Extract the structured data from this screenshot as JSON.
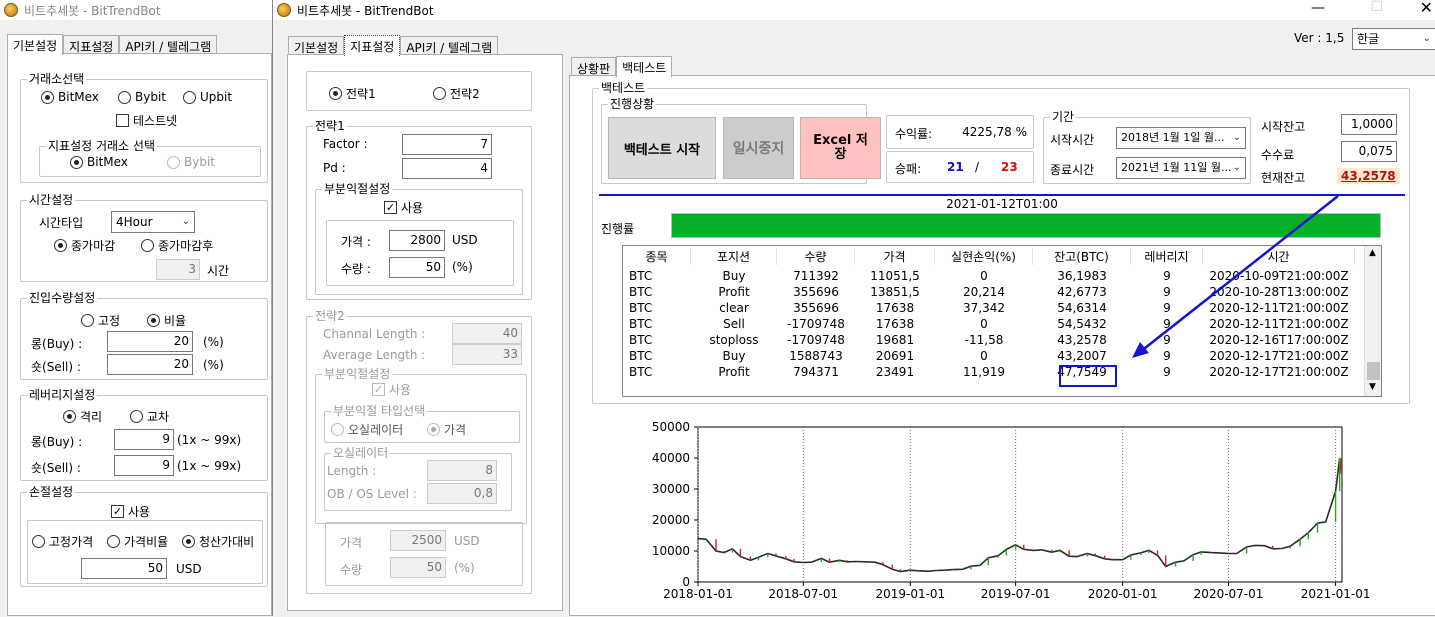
{
  "left_window": {
    "title": "비트추세봇 - BitTrendBot",
    "tabs": [
      "기본설정",
      "지표설정",
      "API키 / 텔레그램"
    ],
    "exchange_group": {
      "legend": "거래소선택",
      "options": [
        "BitMex",
        "Bybit",
        "Upbit"
      ],
      "selected": "BitMex",
      "testnet_label": "테스트넷",
      "indicator_exchange": {
        "legend": "지표설정 거래소 선택",
        "options": [
          "BitMex",
          "Bybit"
        ],
        "selected": "BitMex"
      }
    },
    "time_group": {
      "legend": "시간설정",
      "type_label": "시간타입",
      "type_value": "4Hour",
      "options": [
        "종가마감",
        "종가마감후"
      ],
      "selected": "종가마감",
      "hours_value": "3",
      "hours_unit": "시간"
    },
    "entry_group": {
      "legend": "진입수량설정",
      "options": [
        "고정",
        "비율"
      ],
      "selected": "비율",
      "long_label": "롱(Buy) :",
      "long_value": "20",
      "long_unit": "(%)",
      "short_label": "숏(Sell) :",
      "short_value": "20",
      "short_unit": "(%)"
    },
    "leverage_group": {
      "legend": "레버리지설정",
      "options": [
        "격리",
        "교차"
      ],
      "selected": "격리",
      "long_label": "롱(Buy) :",
      "long_value": "9",
      "long_range": "(1x ~ 99x)",
      "short_label": "숏(Sell) :",
      "short_value": "9",
      "short_range": "(1x ~ 99x)"
    },
    "stoploss_group": {
      "legend": "손절설정",
      "use_label": "사용",
      "options": [
        "고정가격",
        "가격비율",
        "청산가대비"
      ],
      "selected": "청산가대비",
      "value": "50",
      "unit": "USD"
    }
  },
  "mid_window": {
    "title": "비트추세봇 - BitTrendBot",
    "tabs": [
      "기본설정",
      "지표설정",
      "API키 / 텔레그램"
    ],
    "strategy_select": {
      "options": [
        "전략1",
        "전략2"
      ],
      "selected": "전략1"
    },
    "strategy1": {
      "legend": "전략1",
      "factor_label": "Factor :",
      "factor_value": "7",
      "pd_label": "Pd :",
      "pd_value": "4",
      "partial": {
        "legend": "부분익절설정",
        "use_label": "사용",
        "price_label": "가격 :",
        "price_value": "2800",
        "price_unit": "USD",
        "qty_label": "수량 :",
        "qty_value": "50",
        "qty_unit": "(%)"
      }
    },
    "strategy2": {
      "legend": "전략2",
      "channel_label": "Channal Length :",
      "channel_value": "40",
      "avg_label": "Average Length :",
      "avg_value": "33",
      "partial": {
        "legend": "부분익절설정",
        "use_label": "사용",
        "type_legend": "부분익절 타입선택",
        "type_options": [
          "오실레이터",
          "가격"
        ],
        "type_selected": "가격",
        "osc_legend": "오실레이터",
        "length_label": "Length :",
        "length_value": "8",
        "ob_label": "OB / OS Level :",
        "ob_value": "0,8",
        "price_label": "가격",
        "price_value": "2500",
        "price_unit": "USD",
        "qty_label": "수량",
        "qty_value": "50",
        "qty_unit": "(%)"
      }
    }
  },
  "right_panel": {
    "version": "Ver : 1,5",
    "language": "한글",
    "tabs": [
      "상황판",
      "백테스트"
    ],
    "backtest_legend": "백테스트",
    "progress_legend": "진행상황",
    "start_button": "백테스트 시작",
    "pause_button": "일시중지",
    "excel_button": "Excel 저장",
    "return_label": "수익률:",
    "return_value": "4225,78 %",
    "winloss_label": "승패:",
    "wins": "21",
    "sep": "/",
    "losses": "23",
    "period_legend": "기간",
    "start_label": "시작시간",
    "start_value": "2018년  1월  1일 월...",
    "end_label": "종료시간",
    "end_value": "2021년  1월 11일 월...",
    "start_balance_label": "시작잔고",
    "start_balance_value": "1,0000",
    "fee_label": "수수료",
    "fee_value": "0,075",
    "current_balance_label": "현재잔고",
    "current_balance_value": "43,2578",
    "timestamp": "2021-01-12T01:00",
    "progress_label": "진행률",
    "progress_fraction": 1.0,
    "colors": {
      "progress": "#06b025",
      "arrow": "#1414d2",
      "highlight_text": "#b01010",
      "wins": "#1010c0",
      "losses": "#d01010"
    },
    "table": {
      "headers": [
        "종목",
        "포지션",
        "수량",
        "가격",
        "실현손익(%)",
        "잔고(BTC)",
        "레버리지",
        "시간"
      ],
      "rows": [
        [
          "BTC",
          "Buy",
          "711392",
          "11051,5",
          "0",
          "36,1983",
          "9",
          "2020-10-09T21:00:00Z"
        ],
        [
          "BTC",
          "Profit",
          "355696",
          "13851,5",
          "20,214",
          "42,6773",
          "9",
          "2020-10-28T13:00:00Z"
        ],
        [
          "BTC",
          "clear",
          "355696",
          "17638",
          "37,342",
          "54,6314",
          "9",
          "2020-12-11T21:00:00Z"
        ],
        [
          "BTC",
          "Sell",
          "-1709748",
          "17638",
          "0",
          "54,5432",
          "9",
          "2020-12-11T21:00:00Z"
        ],
        [
          "BTC",
          "stoploss",
          "-1709748",
          "19681",
          "-11,58",
          "43,2578",
          "9",
          "2020-12-16T17:00:00Z"
        ],
        [
          "BTC",
          "Buy",
          "1588743",
          "20691",
          "0",
          "43,2007",
          "9",
          "2020-12-17T21:00:00Z"
        ],
        [
          "BTC",
          "Profit",
          "794371",
          "23491",
          "11,919",
          "47,7549",
          "9",
          "2020-12-17T21:00:00Z"
        ]
      ]
    }
  },
  "chart_data": {
    "type": "line",
    "title": "",
    "ylim": [
      0,
      50000
    ],
    "yticks": [
      "0",
      "10000",
      "20000",
      "30000",
      "40000",
      "50000"
    ],
    "xticks": [
      "2018-01-01",
      "2018-07-01",
      "2019-01-01",
      "2019-07-01",
      "2020-01-01",
      "2020-07-01",
      "2021-01-01"
    ],
    "x": [
      "2018-01-01",
      "2018-01-15",
      "2018-02-01",
      "2018-02-15",
      "2018-03-01",
      "2018-03-15",
      "2018-04-01",
      "2018-04-15",
      "2018-05-01",
      "2018-05-15",
      "2018-06-01",
      "2018-06-15",
      "2018-07-01",
      "2018-07-15",
      "2018-08-01",
      "2018-08-15",
      "2018-09-01",
      "2018-09-15",
      "2018-10-01",
      "2018-10-15",
      "2018-11-01",
      "2018-11-15",
      "2018-12-01",
      "2018-12-15",
      "2019-01-01",
      "2019-01-15",
      "2019-02-01",
      "2019-02-15",
      "2019-03-01",
      "2019-03-15",
      "2019-04-01",
      "2019-04-15",
      "2019-05-01",
      "2019-05-15",
      "2019-06-01",
      "2019-06-15",
      "2019-07-01",
      "2019-07-15",
      "2019-08-01",
      "2019-08-15",
      "2019-09-01",
      "2019-09-15",
      "2019-10-01",
      "2019-10-15",
      "2019-11-01",
      "2019-11-15",
      "2019-12-01",
      "2019-12-15",
      "2020-01-01",
      "2020-01-15",
      "2020-02-01",
      "2020-02-15",
      "2020-03-01",
      "2020-03-15",
      "2020-04-01",
      "2020-04-15",
      "2020-05-01",
      "2020-05-15",
      "2020-06-01",
      "2020-06-15",
      "2020-07-01",
      "2020-07-15",
      "2020-08-01",
      "2020-08-15",
      "2020-09-01",
      "2020-09-15",
      "2020-10-01",
      "2020-10-15",
      "2020-11-01",
      "2020-11-15",
      "2020-12-01",
      "2020-12-15",
      "2021-01-01",
      "2021-01-08",
      "2021-01-11"
    ],
    "series": [
      {
        "values": [
          14000,
          13800,
          10000,
          9500,
          10700,
          8200,
          7000,
          8000,
          9200,
          8400,
          7500,
          6500,
          6300,
          6400,
          7600,
          6400,
          7000,
          6500,
          6600,
          6500,
          6400,
          5600,
          4100,
          3400,
          3800,
          3600,
          3500,
          3700,
          3800,
          4000,
          4100,
          5100,
          5400,
          7800,
          8500,
          10500,
          12000,
          10500,
          10200,
          10400,
          9600,
          10200,
          8300,
          8200,
          9200,
          8500,
          7500,
          7200,
          7200,
          8700,
          9400,
          10200,
          8600,
          5000,
          6400,
          6800,
          8800,
          9700,
          9500,
          9400,
          9200,
          9200,
          11300,
          11800,
          11700,
          10700,
          10800,
          11500,
          13800,
          15900,
          19000,
          19400,
          29300,
          40000,
          35000
        ]
      }
    ]
  }
}
